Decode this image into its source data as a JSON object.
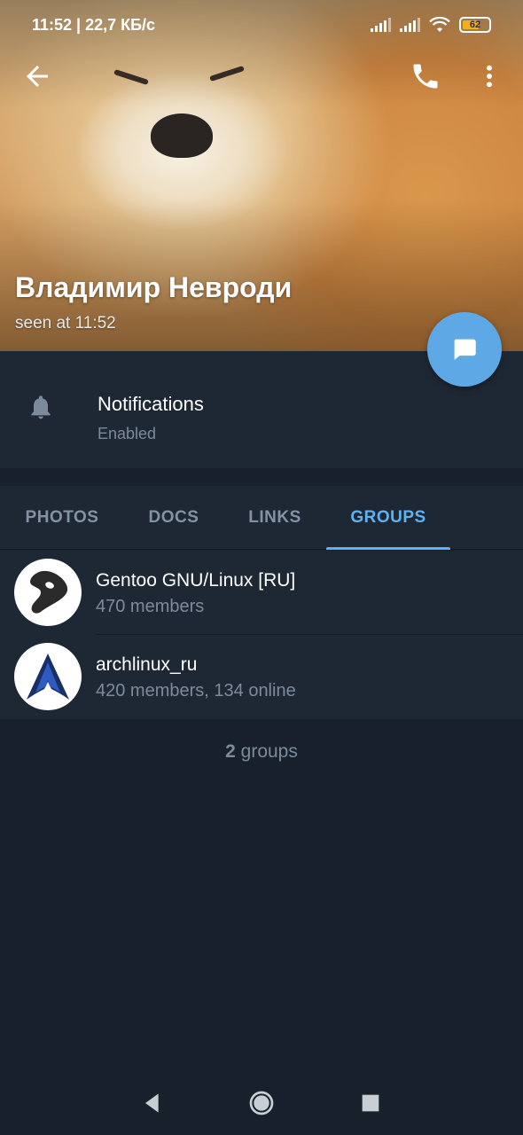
{
  "status_bar": {
    "time_speed": "11:52 | 22,7 КБ/с",
    "battery": "62"
  },
  "toolbar": {
    "back_icon": "arrow-left-icon",
    "call_icon": "phone-icon",
    "menu_icon": "more-vertical-icon"
  },
  "profile": {
    "name": "Владимир  Невроди",
    "last_seen": "seen at 11:52",
    "fab_icon": "message-icon"
  },
  "notifications": {
    "icon": "bell-icon",
    "title": "Notifications",
    "value": "Enabled"
  },
  "tabs": [
    {
      "label": "PHOTOS",
      "active": false
    },
    {
      "label": "DOCS",
      "active": false
    },
    {
      "label": "LINKS",
      "active": false
    },
    {
      "label": "GROUPS",
      "active": true
    }
  ],
  "groups": [
    {
      "name": "Gentoo GNU/Linux [RU]",
      "subtitle": "470 members",
      "avatar": "gentoo-logo-icon"
    },
    {
      "name": "archlinux_ru",
      "subtitle": "420 members, 134 online",
      "avatar": "archlinux-logo-icon"
    }
  ],
  "groups_count": {
    "number": "2",
    "label": "groups"
  },
  "colors": {
    "accent": "#5fb1f0",
    "background": "#17202b",
    "surface": "#1e2834",
    "fab": "#5ea9e5"
  }
}
